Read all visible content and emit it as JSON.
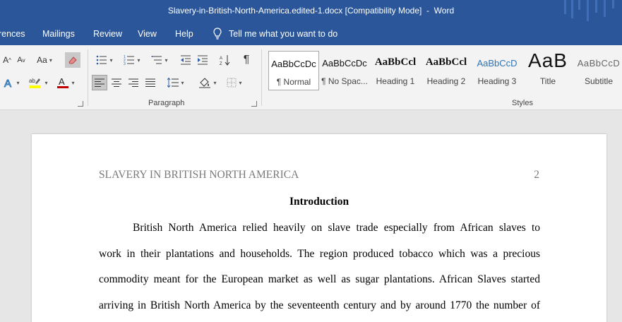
{
  "window": {
    "title": "Slavery-in-British-North-America.edited-1.docx [Compatibility Mode]  -  Word"
  },
  "menu": {
    "tabs": [
      "rences",
      "Mailings",
      "Review",
      "View",
      "Help"
    ],
    "tell_me": "Tell me what you want to do"
  },
  "ribbon": {
    "font_group": {
      "grow_label": "A",
      "shrink_label": "A",
      "case_label": "Aa"
    },
    "paragraph_label": "Paragraph",
    "styles_label": "Styles",
    "styles": [
      {
        "sample": "AaBbCcDc",
        "name": "¶ Normal",
        "selected": true
      },
      {
        "sample": "AaBbCcDc",
        "name": "¶ No Spac..."
      },
      {
        "sample": "AaBbCcl",
        "name": "Heading 1"
      },
      {
        "sample": "AaBbCcl",
        "name": "Heading 2"
      },
      {
        "sample": "AaBbCcD",
        "name": "Heading 3"
      },
      {
        "sample": "AaB",
        "name": "Title"
      },
      {
        "sample": "AaBbCcD",
        "name": "Subtitle"
      }
    ]
  },
  "document": {
    "running_head": "SLAVERY IN BRITISH NORTH AMERICA",
    "page_number": "2",
    "heading": "Introduction",
    "lines": [
      "British North America relied heavily on slave trade especially from African slaves to",
      "work in their plantations and households. The region produced tobacco which was a precious",
      "commodity meant for the European market as well as sugar plantations. African Slaves started",
      "arriving in British North America by the seventeenth century and by around 1770 the number of"
    ]
  },
  "colors": {
    "title_bar": "#2b579a",
    "ribbon": "#f3f3f3",
    "canvas": "#e6e6e6",
    "heading_style_blue": "#2e74b5",
    "highlight_yellow": "#ffff00",
    "font_color_red": "#c00000"
  }
}
